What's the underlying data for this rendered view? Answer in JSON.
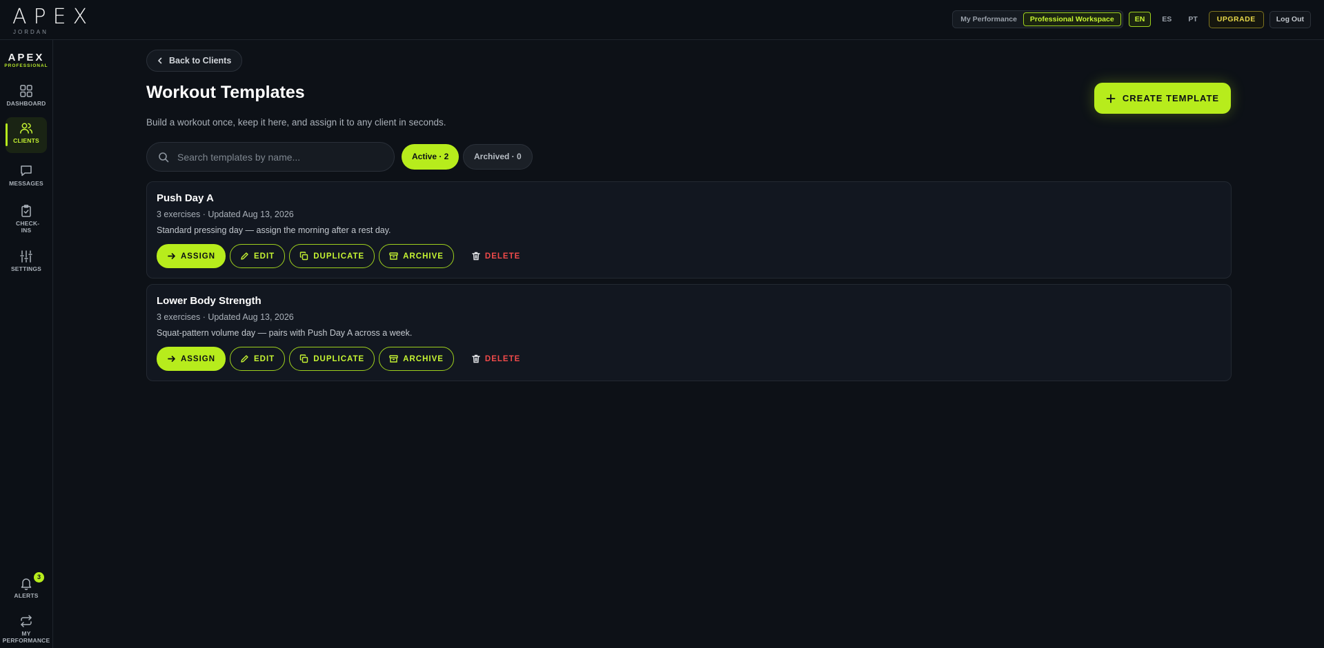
{
  "header": {
    "logo": "APEX",
    "user_name": "JORDAN",
    "workspace_switch": {
      "my_performance": "My Performance",
      "professional": "Professional Workspace"
    },
    "languages": [
      "EN",
      "ES",
      "PT"
    ],
    "upgrade": "UPGRADE",
    "logout": "Log Out"
  },
  "sidebar": {
    "brand_title": "APEX",
    "brand_sub": "PROFESSIONAL",
    "items": [
      {
        "label": "DASHBOARD",
        "icon": "grid-icon"
      },
      {
        "label": "CLIENTS",
        "icon": "users-icon",
        "active": true
      },
      {
        "label": "MESSAGES",
        "icon": "message-icon"
      },
      {
        "label": "CHECK-INS",
        "icon": "clipboard-check-icon"
      },
      {
        "label": "SETTINGS",
        "icon": "sliders-icon"
      }
    ],
    "bottom": [
      {
        "label": "ALERTS",
        "icon": "bell-icon",
        "badge": "3"
      },
      {
        "label": "MY PERFORMANCE",
        "icon": "swap-icon"
      }
    ]
  },
  "main": {
    "back": "Back to Clients",
    "title": "Workout Templates",
    "subtitle": "Build a workout once, keep it here, and assign it to any client in seconds.",
    "create": "CREATE TEMPLATE",
    "search_placeholder": "Search templates by name...",
    "filters": {
      "active": "Active · 2",
      "archived": "Archived · 0"
    },
    "actions": {
      "assign": "ASSIGN",
      "edit": "EDIT",
      "duplicate": "DUPLICATE",
      "archive": "ARCHIVE",
      "delete": "DELETE"
    },
    "templates": [
      {
        "title": "Push Day A",
        "meta": "3 exercises · Updated Aug 13, 2026",
        "description": "Standard pressing day — assign the morning after a rest day."
      },
      {
        "title": "Lower Body Strength",
        "meta": "3 exercises · Updated Aug 13, 2026",
        "description": "Squat-pattern volume day — pairs with Push Day A across a week."
      }
    ]
  },
  "colors": {
    "accent": "#b7ec1c",
    "background": "#0d1117",
    "danger": "#f04a4a",
    "upgrade": "#e8d84a"
  }
}
